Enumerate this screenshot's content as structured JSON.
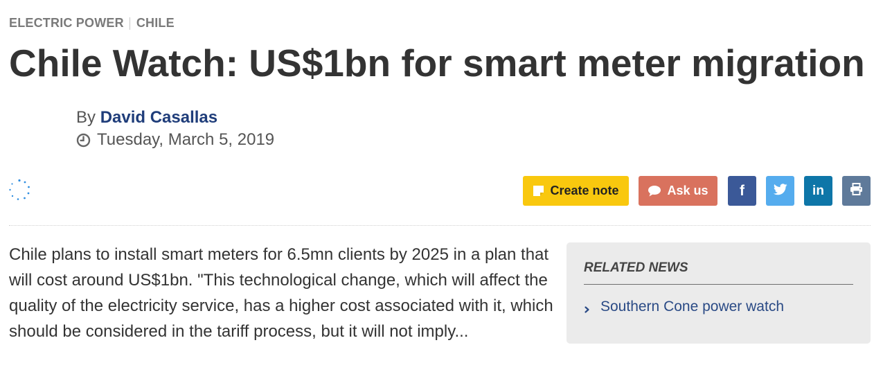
{
  "breadcrumb": {
    "section": "ELECTRIC POWER",
    "country": "CHILE"
  },
  "article": {
    "title": "Chile Watch: US$1bn for smart meter migration",
    "by_label": "By",
    "author": "David Casallas",
    "date": "Tuesday, March 5, 2019",
    "summary": "Chile plans to install smart meters for 6.5mn clients by 2025 in a plan that will cost around US$1bn. \"This technological change, which will affect the quality of the electricity service, has a higher cost associated with it, which should be considered in the tariff process, but it will not imply..."
  },
  "actions": {
    "create_note": "Create note",
    "ask_us": "Ask us",
    "facebook_icon": "f",
    "twitter_icon": "twitter-bird-icon",
    "linkedin_icon": "in",
    "print_icon": "printer-icon"
  },
  "related": {
    "heading": "RELATED NEWS",
    "items": [
      {
        "label": "Southern Cone power watch"
      }
    ]
  },
  "colors": {
    "note": "#f9c80e",
    "ask": "#d9725e",
    "facebook": "#3b5998",
    "twitter": "#55acee",
    "linkedin": "#0e76a8",
    "print": "#5f7a9a",
    "link": "#1f3d7a"
  }
}
